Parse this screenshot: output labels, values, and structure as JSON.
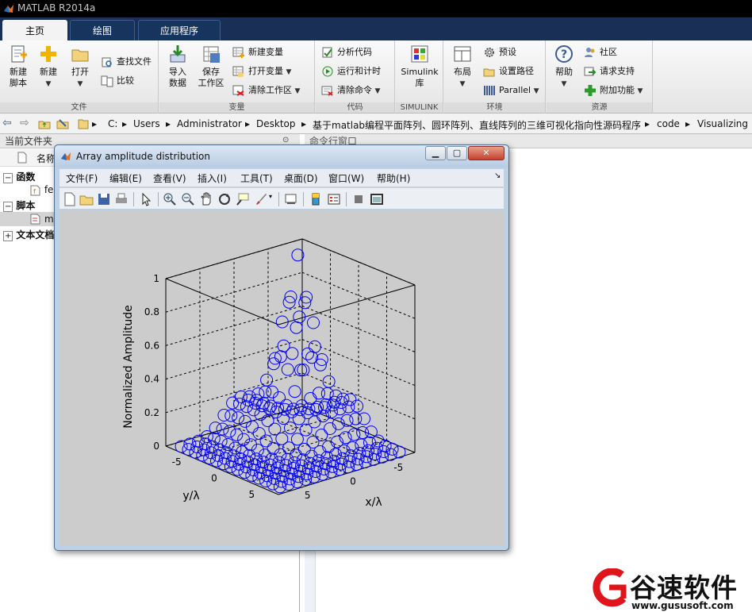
{
  "app": {
    "title": "MATLAB R2014a"
  },
  "tabs": [
    {
      "label": "主页",
      "active": true
    },
    {
      "label": "绘图",
      "active": false
    },
    {
      "label": "应用程序",
      "active": false
    }
  ],
  "ribbon": {
    "file": {
      "label": "文件",
      "new_script": "新建\n脚本",
      "new": "新建",
      "open": "打开",
      "find_files": "查找文件",
      "compare": "比较"
    },
    "variable": {
      "label": "变量",
      "import": "导入\n数据",
      "save_ws": "保存\n工作区",
      "new_var": "新建变量",
      "open_var": "打开变量",
      "clear_ws": "清除工作区"
    },
    "code": {
      "label": "代码",
      "analyze": "分析代码",
      "run_time": "运行和计时",
      "clear_cmd": "清除命令"
    },
    "simulink": {
      "label": "SIMULINK",
      "lib": "Simulink\n库"
    },
    "env": {
      "label": "环境",
      "layout": "布局",
      "prefs": "预设",
      "set_path": "设置路径",
      "parallel": "Parallel"
    },
    "resources": {
      "label": "资源",
      "help": "帮助",
      "community": "社区",
      "support": "请求支持",
      "addons": "附加功能"
    }
  },
  "address": {
    "segments": [
      "C:",
      "Users",
      "Administrator",
      "Desktop",
      "基于matlab编程平面阵列、圆环阵列、直线阵列的三维可视化指向性源码程序",
      "code",
      "Visualizing"
    ]
  },
  "left_pane": {
    "header": "当前文件夹",
    "name_col": "名称",
    "groups": [
      {
        "label": "函数",
        "item": "fe"
      },
      {
        "label": "脚本",
        "item": "m"
      },
      {
        "label": "文本文档",
        "item": ""
      }
    ]
  },
  "right_pane": {
    "header": "命令行窗口"
  },
  "figure": {
    "title": "Array amplitude distribution",
    "menu": [
      "文件(F)",
      "编辑(E)",
      "查看(V)",
      "插入(I)",
      "工具(T)",
      "桌面(D)",
      "窗口(W)",
      "帮助(H)"
    ],
    "toolbar_icons": [
      "new-figure-icon",
      "open-icon",
      "save-icon",
      "print-icon",
      "pointer-icon",
      "zoom-in-icon",
      "zoom-out-icon",
      "pan-icon",
      "rotate-icon",
      "data-cursor-icon",
      "brush-icon",
      "link-icon",
      "colorbar-icon",
      "legend-icon",
      "hide-tools-icon",
      "show-tools-icon"
    ]
  },
  "chart_data": {
    "type": "scatter",
    "title": "",
    "xlabel": "x/λ",
    "ylabel": "y/λ",
    "zlabel": "Normalized Amplitude",
    "xticks": [
      "5",
      "0",
      "-5"
    ],
    "yticks": [
      "-5",
      "0",
      "5"
    ],
    "zticks": [
      "0",
      "0.2",
      "0.4",
      "0.6",
      "0.8",
      "1"
    ],
    "zlim": [
      0,
      1
    ],
    "xlim": [
      -8,
      8
    ],
    "ylim": [
      -8,
      8
    ],
    "grid": true,
    "marker": "o",
    "marker_color": "#0000ff",
    "description_of_points": "amplitude of circular/planar array elements, peak near x=-4..-6, y=-4..-6",
    "points": []
  },
  "watermark": {
    "brand": "谷速软件",
    "url": "www.gususoft.com"
  },
  "colors": {
    "accent": "#1a2f55",
    "marker": "#0000ff",
    "figure_bg": "#cccccc"
  }
}
